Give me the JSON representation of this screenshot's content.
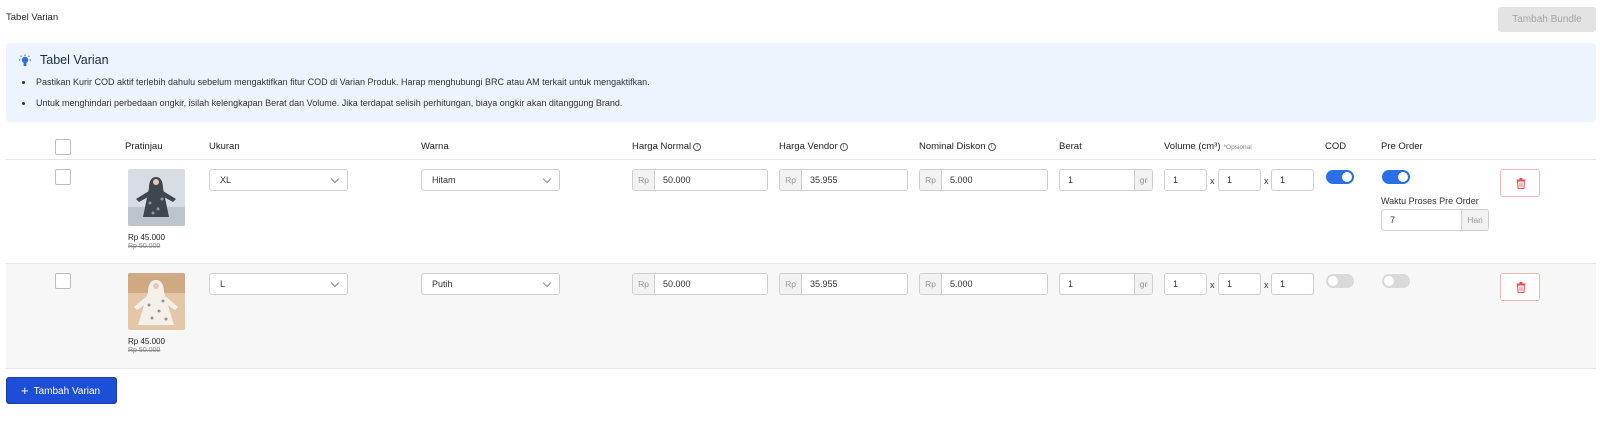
{
  "header": {
    "title": "Tabel Varian",
    "bundle_button": "Tambah Bundle"
  },
  "info": {
    "title": "Tabel Varian",
    "icon": "lightbulb-icon",
    "bullets": [
      "Pastikan Kurir COD aktif terlebih dahulu sebelum mengaktifkan fitur COD di Varian Produk. Harap menghubungi BRC atau AM terkait untuk mengaktifkan.",
      "Untuk menghindari perbedaan ongkir, isilah kelengkapan Berat dan Volume. Jika terdapat selisih perhitungan, biaya ongkir akan ditanggung Brand."
    ]
  },
  "table": {
    "columns": {
      "preview": "Pratinjau",
      "size": "Ukuran",
      "color": "Warna",
      "normal_price": "Harga Normal",
      "vendor_price": "Harga Vendor",
      "discount": "Nominal Diskon",
      "weight": "Berat",
      "volume": "Volume (cm³)",
      "optional": "*Opsional",
      "cod": "COD",
      "pre_order": "Pre Order"
    },
    "currency": "Rp",
    "weight_unit": "gr",
    "dim_separator": "x",
    "rows": [
      {
        "price": "Rp 45.000",
        "price_old": "Rp 50.000",
        "size": "XL",
        "color": "Hitam",
        "normal_price": "50.000",
        "vendor_price": "35.955",
        "discount": "5.000",
        "weight": "1",
        "length": "1",
        "width": "1",
        "height": "1",
        "cod_enabled": true,
        "pre_order_enabled": true,
        "pre_order_label": "Waktu Proses Pre Order",
        "pre_order_days": "7",
        "pre_order_unit": "Hari"
      },
      {
        "price": "Rp 45.000",
        "price_old": "Rp 50.000",
        "size": "L",
        "color": "Putih",
        "normal_price": "50.000",
        "vendor_price": "35.955",
        "discount": "5.000",
        "weight": "1",
        "length": "1",
        "width": "1",
        "height": "1",
        "cod_enabled": false,
        "pre_order_enabled": false
      }
    ]
  },
  "footer": {
    "add_button": "Tambah Varian"
  },
  "colors": {
    "accent": "#2a6fe6",
    "primary_button": "#1d4ed8",
    "info_background": "#edf4fd",
    "delete_border": "#f0b9b9",
    "delete_icon": "#e05252"
  }
}
